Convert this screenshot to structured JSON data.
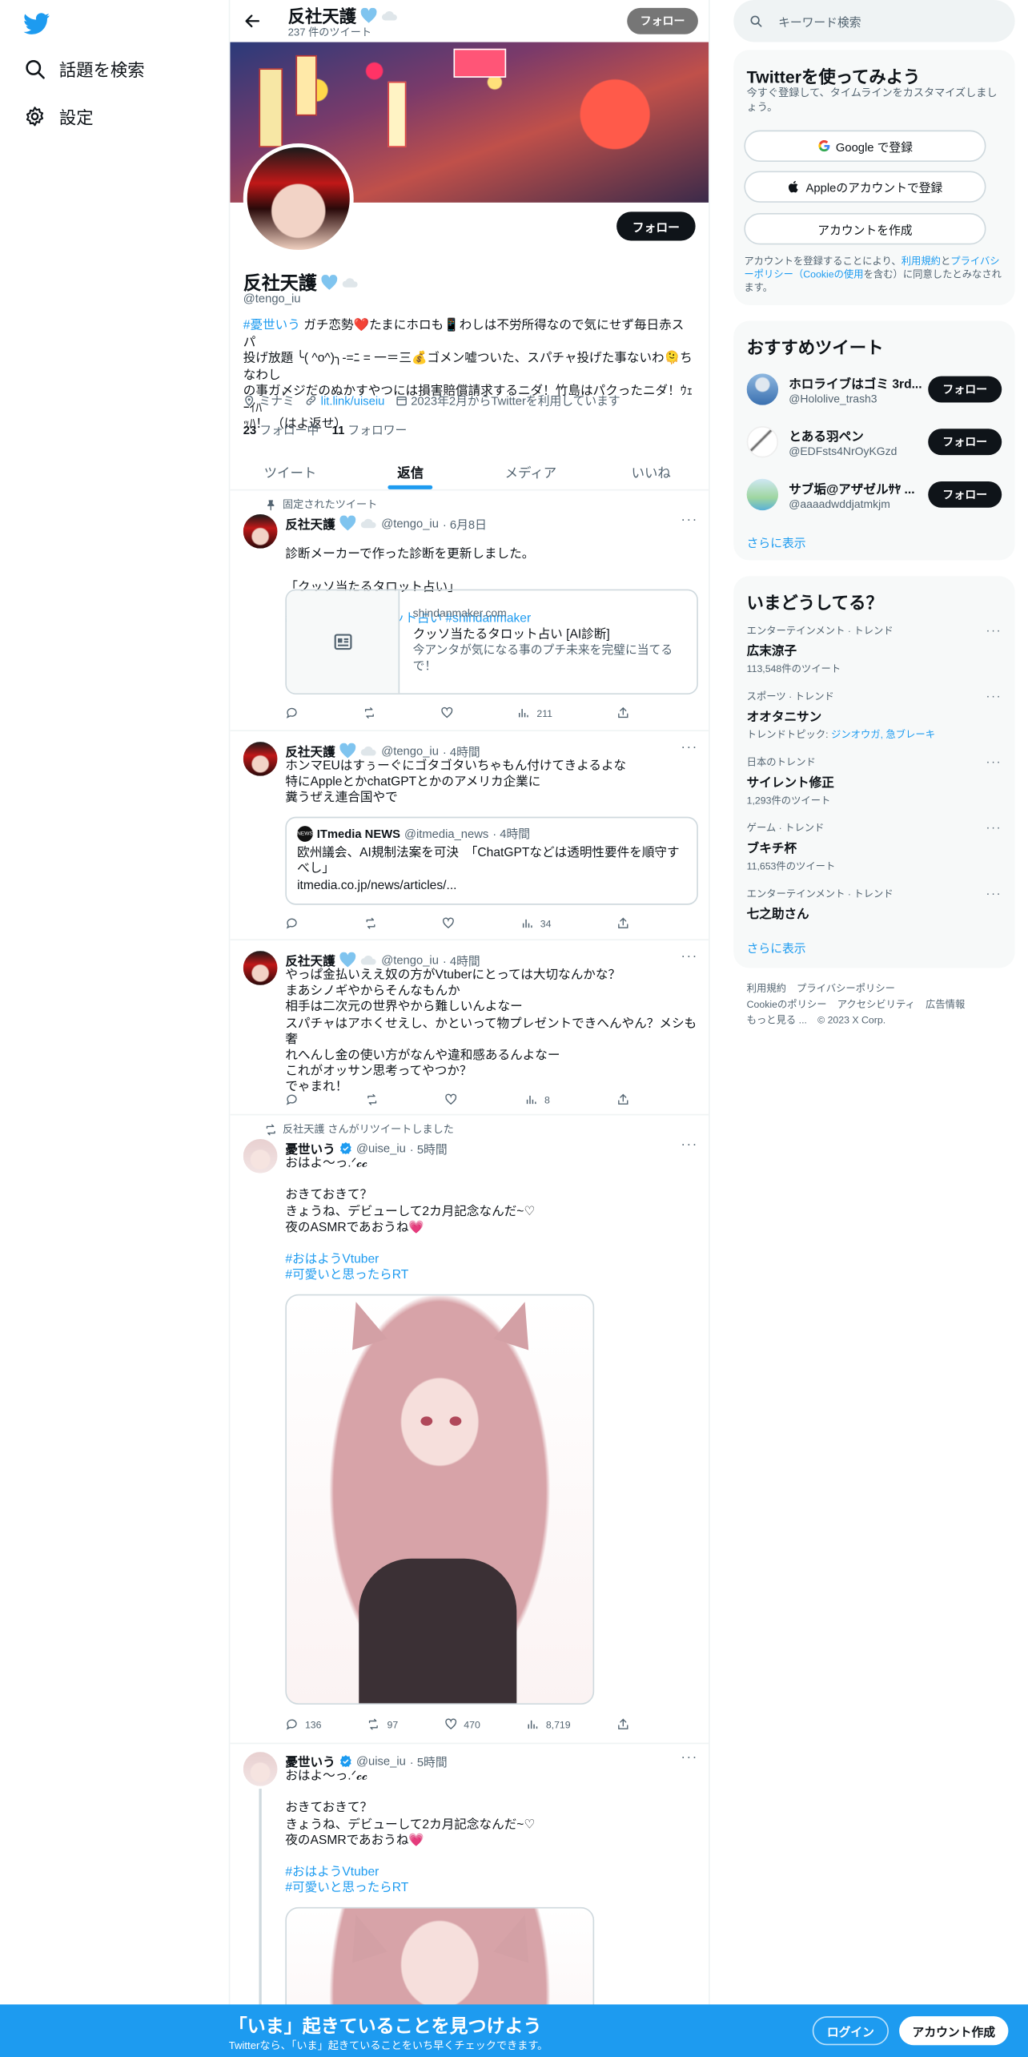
{
  "colors": {
    "accent": "#1d9bf0",
    "text": "#0f1419",
    "muted": "#536471",
    "border": "#eff3f4"
  },
  "nav": {
    "items": [
      {
        "icon": "search-icon",
        "label": "話題を検索"
      },
      {
        "icon": "gear-icon",
        "label": "設定"
      }
    ]
  },
  "header": {
    "name": "反社天護",
    "tweet_count": "237 件のツイート",
    "follow": "フォロー"
  },
  "profile": {
    "name": "反社天護",
    "handle": "@tengo_iu",
    "follow": "フォロー",
    "bio_hashtag": "#憂世いう",
    "bio_line1": " ガチ恋勢❤️たまにホロも📱わしは不労所得なので気にせず毎日赤スパ",
    "bio_line2": "投げ放題 ╰( ^o^)╮-=ﾆ = 一＝三💰ゴメン嘘ついた、スパチャ投げた事ないわ🫠ちなわし",
    "bio_line3": "の事ガ〆ジだのぬかすやつには損害賠償請求するニダ！竹島はパクったニダ！ｳｪｰｲﾊ",
    "bio_line4": "ｯﾊ！ （はよ返せ）",
    "location": "ミナミ",
    "website": "lit.link/uiseiu",
    "joined": "2023年2月からTwitterを利用しています",
    "following_count": "23",
    "following_label": "フォロー中",
    "followers_count": "11",
    "followers_label": "フォロワー"
  },
  "tabs": [
    {
      "label": "ツイート"
    },
    {
      "label": "返信"
    },
    {
      "label": "メディア"
    },
    {
      "label": "いいね"
    }
  ],
  "tweets": {
    "t1": {
      "context": "固定されたツイート",
      "name": "反社天護",
      "handle": "@tengo_iu",
      "time": "· 6月8日",
      "line1": "診断メーカーで作った診断を更新しました。",
      "line2": "「クッソ当たるタロット占い」",
      "tags": "#クッソ当たるタロット占い #shindanmaker",
      "card_domain": "shindanmaker.com",
      "card_title": "クッソ当たるタロット占い [AI診断]",
      "card_desc": "今アンタが気になる事のプチ未来を完璧に当てるで！",
      "views": "211"
    },
    "t2": {
      "name": "反社天護",
      "handle": "@tengo_iu",
      "time": "· 4時間",
      "text": "ホンマEUはすぅーぐにゴタゴタいちゃもん付けてきよるよな\n特にAppleとかchatGPTとかのアメリカ企業に\n糞うぜえ連合国やで",
      "quote_name": "ITmedia NEWS",
      "quote_handle": "@itmedia_news",
      "quote_time": "· 4時間",
      "quote_text": "欧州議会、AI規制法案を可決　「ChatGPTなどは透明性要件を順守すべし」",
      "quote_link": "itmedia.co.jp/news/articles/...",
      "views": "34"
    },
    "t3": {
      "name": "反社天護",
      "handle": "@tengo_iu",
      "time": "· 4時間",
      "text": "やっぱ金払いええ奴の方がVtuberにとっては大切なんかな？\nまあシノギやからそんなもんか\n相手は二次元の世界やから難しいんよなー\nスパチャはアホくせえし、かといって物プレゼントできへんやん？メシも奢\nれへんし金の使い方がなんや違和感あるんよなー\nこれがオッサン思考ってやつか？\nでゃまれ！",
      "views": "8"
    },
    "t4": {
      "context": "反社天護 さんがリツイートしました",
      "name": "憂世いう",
      "handle": "@uise_iu",
      "time": "· 5時間",
      "text": "おはよ～っ.ᐟ𝓬𝓬\n\nおきておきて？\nきょうね、デビューして2カ月記念なんだ~♡\n夜のASMRであおうね💗",
      "tag1": "#おはようVtuber",
      "tag2": "#可愛いと思ったらRT",
      "replies": "136",
      "retweets": "97",
      "likes": "470",
      "views": "8,719"
    },
    "t5": {
      "name": "憂世いう",
      "handle": "@uise_iu",
      "time": "· 5時間",
      "text": "おはよ～っ.ᐟ𝓬𝓬\n\nおきておきて？\nきょうね、デビューして2カ月記念なんだ~♡\n夜のASMRであおうね💗",
      "tag1": "#おはようVtuber",
      "tag2": "#可愛いと思ったらRT"
    }
  },
  "right": {
    "search_placeholder": "キーワード検索",
    "signup_title": "Twitterを使ってみよう",
    "signup_sub": "今すぐ登録して、タイムラインをカスタマイズしましょう。",
    "google_btn": "Google で登録",
    "apple_btn": "Appleのアカウントで登録",
    "create_btn": "アカウントを作成",
    "terms_pre": "アカウントを登録することにより、",
    "terms_link1": "利用規約",
    "terms_mid": "と",
    "terms_link2": "プライバシーポリシー（Cookieの使用",
    "terms_post": "を含む）に同意したとみなされます。",
    "rec_title": "おすすめツイート",
    "recs": [
      {
        "name": "ホロライブはゴミ 3rd...",
        "handle": "@Hololive_trash3",
        "follow": "フォロー"
      },
      {
        "name": "とある羽ペン",
        "handle": "@EDFsts4NrOyKGzd",
        "follow": "フォロー"
      },
      {
        "name": "サブ垢@アザゼルｻﾔ ...",
        "handle": "@aaaadwddjatmkjm",
        "follow": "フォロー"
      }
    ],
    "show_more": "さらに表示",
    "trends_title": "いまどうしてる？",
    "trends": [
      {
        "context": "エンターテインメント · トレンド",
        "name": "広末涼子",
        "count": "113,548件のツイート"
      },
      {
        "context": "スポーツ · トレンド",
        "name": "オオタニサン",
        "count": "トレンドトピック: ",
        "links": "ジンオウガ, 急ブレーキ"
      },
      {
        "context": "日本のトレンド",
        "name": "サイレント修正",
        "count": "1,293件のツイート"
      },
      {
        "context": "ゲーム · トレンド",
        "name": "ブキチ杯",
        "count": "11,653件のツイート"
      },
      {
        "context": "エンターテインメント · トレンド",
        "name": "七之助さん",
        "count": ""
      }
    ],
    "trends_more": "さらに表示",
    "footer": {
      "terms": "利用規約",
      "privacy": "プライバシーポリシー",
      "cookie": "Cookieのポリシー",
      "accessibility": "アクセシビリティ",
      "ads": "広告情報",
      "more": "もっと見る ...",
      "copyright": "© 2023 X Corp."
    }
  },
  "bottom": {
    "title": "「いま」起きていることを見つけよう",
    "sub": "Twitterなら、「いま」起きていることをいち早くチェックできます。",
    "login": "ログイン",
    "signup": "アカウント作成"
  }
}
